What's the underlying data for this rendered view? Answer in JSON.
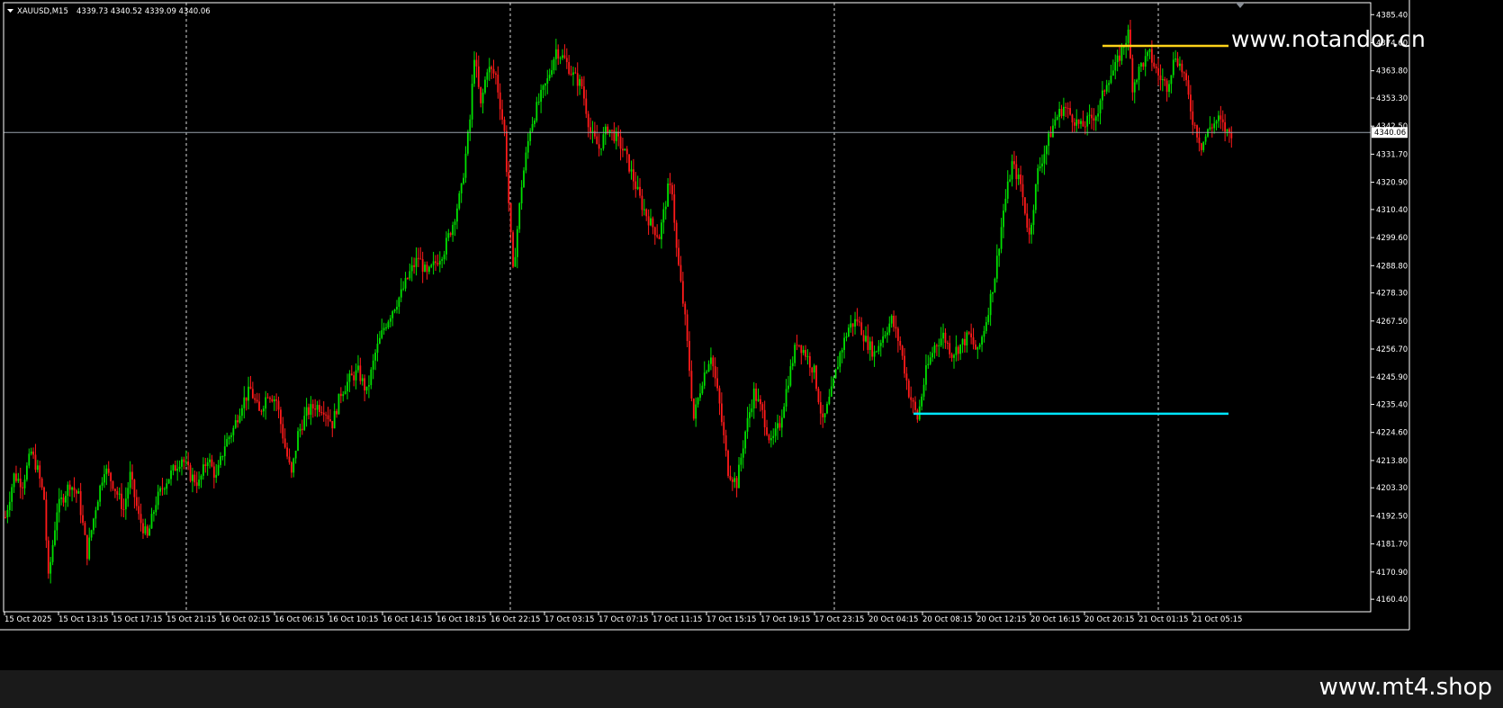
{
  "header": {
    "symbol": "XAUUSD,M15",
    "ohlc": "4339.73 4340.52 4339.09 4340.06",
    "dropdown_icon": "triangle-down-icon"
  },
  "watermark": "www.notandor.cn",
  "footer": {
    "brand": "www.mt4.shop"
  },
  "colors": {
    "background": "#000000",
    "bull": "#00e000",
    "bear": "#ff1a1a",
    "axis": "#ffffff",
    "support": "#00e5ff",
    "resistance": "#ffd21a",
    "bid_line": "#9aa3ad"
  },
  "chart_data": {
    "type": "candlestick",
    "symbol": "XAUUSD",
    "timeframe": "M15",
    "ylim": [
      4155.6,
      4390.0
    ],
    "y_ticks": [
      "4385.40",
      "4374.60",
      "4363.80",
      "4353.30",
      "4342.50",
      "4331.70",
      "4320.90",
      "4310.40",
      "4299.60",
      "4288.80",
      "4278.30",
      "4267.50",
      "4256.70",
      "4245.90",
      "4235.40",
      "4224.60",
      "4213.80",
      "4203.30",
      "4192.50",
      "4181.70",
      "4170.90",
      "4160.40"
    ],
    "x_ticks": [
      "15 Oct 2025",
      "15 Oct 13:15",
      "15 Oct 17:15",
      "15 Oct 21:15",
      "16 Oct 02:15",
      "16 Oct 06:15",
      "16 Oct 10:15",
      "16 Oct 14:15",
      "16 Oct 18:15",
      "16 Oct 22:15",
      "17 Oct 03:15",
      "17 Oct 07:15",
      "17 Oct 11:15",
      "17 Oct 15:15",
      "17 Oct 19:15",
      "17 Oct 23:15",
      "20 Oct 04:15",
      "20 Oct 08:15",
      "20 Oct 12:15",
      "20 Oct 16:15",
      "20 Oct 20:15",
      "21 Oct 01:15",
      "21 Oct 05:15"
    ],
    "day_separators": [
      "15 Oct 21:15",
      "16 Oct 22:15",
      "17 Oct 23:15",
      "21 Oct 01:15"
    ],
    "current_price": "4340.06",
    "support_level": 4231.8,
    "resistance_level": 4373.4,
    "support_span": [
      "20 Oct 04:15",
      "21 Oct 05:15"
    ],
    "resistance_span": [
      "20 Oct 16:15",
      "21 Oct 05:15"
    ],
    "price_path": [
      [
        0,
        4192
      ],
      [
        4,
        4208
      ],
      [
        8,
        4205
      ],
      [
        12,
        4217
      ],
      [
        15,
        4210
      ],
      [
        18,
        4199
      ],
      [
        20,
        4168
      ],
      [
        24,
        4195
      ],
      [
        30,
        4205
      ],
      [
        34,
        4200
      ],
      [
        38,
        4178
      ],
      [
        42,
        4196
      ],
      [
        46,
        4211
      ],
      [
        50,
        4205
      ],
      [
        55,
        4195
      ],
      [
        58,
        4208
      ],
      [
        62,
        4192
      ],
      [
        66,
        4184
      ],
      [
        70,
        4198
      ],
      [
        74,
        4205
      ],
      [
        78,
        4210
      ],
      [
        82,
        4215
      ],
      [
        86,
        4208
      ],
      [
        90,
        4205
      ],
      [
        94,
        4215
      ],
      [
        98,
        4207
      ],
      [
        102,
        4220
      ],
      [
        106,
        4226
      ],
      [
        110,
        4236
      ],
      [
        114,
        4241
      ],
      [
        118,
        4232
      ],
      [
        122,
        4240
      ],
      [
        126,
        4237
      ],
      [
        130,
        4219
      ],
      [
        133,
        4208
      ],
      [
        136,
        4224
      ],
      [
        140,
        4232
      ],
      [
        144,
        4235
      ],
      [
        148,
        4234
      ],
      [
        152,
        4228
      ],
      [
        156,
        4240
      ],
      [
        160,
        4245
      ],
      [
        164,
        4248
      ],
      [
        168,
        4240
      ],
      [
        172,
        4255
      ],
      [
        176,
        4265
      ],
      [
        180,
        4272
      ],
      [
        184,
        4278
      ],
      [
        188,
        4286
      ],
      [
        192,
        4292
      ],
      [
        196,
        4285
      ],
      [
        200,
        4290
      ],
      [
        204,
        4295
      ],
      [
        208,
        4305
      ],
      [
        212,
        4318
      ],
      [
        216,
        4345
      ],
      [
        218,
        4370
      ],
      [
        221,
        4350
      ],
      [
        224,
        4365
      ],
      [
        228,
        4362
      ],
      [
        232,
        4340
      ],
      [
        236,
        4286
      ],
      [
        240,
        4320
      ],
      [
        244,
        4342
      ],
      [
        248,
        4352
      ],
      [
        252,
        4360
      ],
      [
        256,
        4372
      ],
      [
        260,
        4368
      ],
      [
        264,
        4362
      ],
      [
        268,
        4358
      ],
      [
        272,
        4340
      ],
      [
        276,
        4334
      ],
      [
        280,
        4342
      ],
      [
        284,
        4338
      ],
      [
        288,
        4332
      ],
      [
        292,
        4322
      ],
      [
        296,
        4312
      ],
      [
        300,
        4305
      ],
      [
        304,
        4300
      ],
      [
        308,
        4318
      ],
      [
        310,
        4318
      ],
      [
        312,
        4295
      ],
      [
        316,
        4268
      ],
      [
        320,
        4230
      ],
      [
        324,
        4245
      ],
      [
        328,
        4255
      ],
      [
        332,
        4235
      ],
      [
        336,
        4210
      ],
      [
        340,
        4205
      ],
      [
        344,
        4225
      ],
      [
        348,
        4240
      ],
      [
        352,
        4232
      ],
      [
        356,
        4220
      ],
      [
        360,
        4228
      ],
      [
        364,
        4245
      ],
      [
        368,
        4260
      ],
      [
        372,
        4255
      ],
      [
        376,
        4248
      ],
      [
        380,
        4228
      ],
      [
        384,
        4240
      ],
      [
        388,
        4255
      ],
      [
        392,
        4265
      ],
      [
        396,
        4268
      ],
      [
        400,
        4260
      ],
      [
        404,
        4255
      ],
      [
        408,
        4262
      ],
      [
        412,
        4268
      ],
      [
        416,
        4258
      ],
      [
        420,
        4240
      ],
      [
        424,
        4230
      ],
      [
        428,
        4248
      ],
      [
        432,
        4258
      ],
      [
        436,
        4262
      ],
      [
        440,
        4255
      ],
      [
        444,
        4258
      ],
      [
        448,
        4262
      ],
      [
        452,
        4255
      ],
      [
        456,
        4268
      ],
      [
        460,
        4285
      ],
      [
        464,
        4310
      ],
      [
        468,
        4328
      ],
      [
        472,
        4320
      ],
      [
        476,
        4300
      ],
      [
        480,
        4325
      ],
      [
        484,
        4335
      ],
      [
        488,
        4345
      ],
      [
        492,
        4350
      ],
      [
        496,
        4346
      ],
      [
        500,
        4342
      ],
      [
        504,
        4345
      ],
      [
        508,
        4348
      ],
      [
        512,
        4360
      ],
      [
        516,
        4365
      ],
      [
        520,
        4374
      ],
      [
        522,
        4378
      ],
      [
        524,
        4358
      ],
      [
        528,
        4366
      ],
      [
        532,
        4370
      ],
      [
        536,
        4362
      ],
      [
        540,
        4358
      ],
      [
        544,
        4370
      ],
      [
        548,
        4362
      ],
      [
        552,
        4345
      ],
      [
        556,
        4335
      ],
      [
        560,
        4342
      ],
      [
        564,
        4345
      ],
      [
        568,
        4340
      ],
      [
        570,
        4340.06
      ]
    ]
  }
}
